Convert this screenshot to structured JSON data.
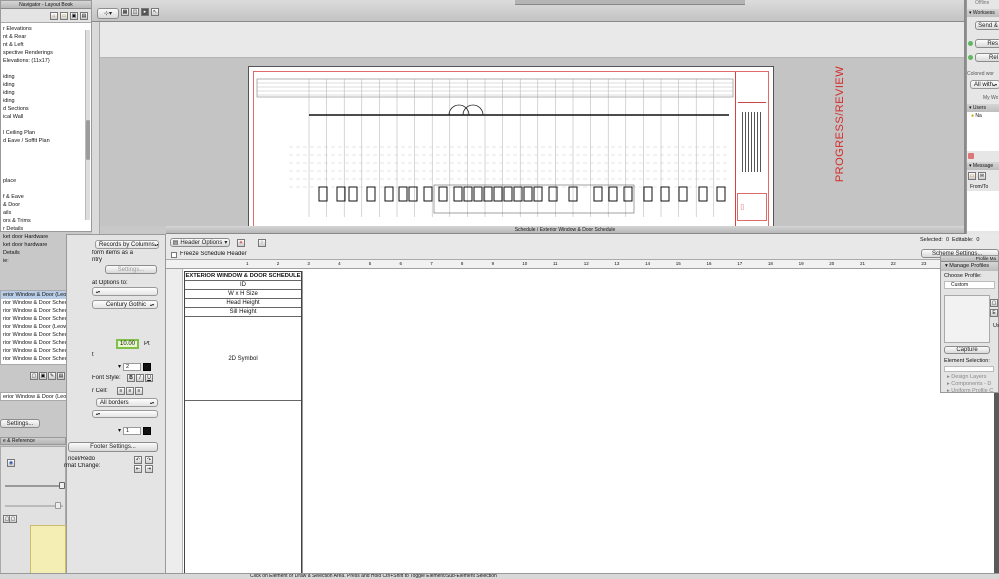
{
  "navigator": {
    "title": "Navigator - Layout Book",
    "items": [
      "r Elevations",
      "nt & Rear",
      "nt & Left",
      "spective Renderings",
      "Elevations: (11x17)",
      "",
      "iding",
      "iding",
      "iding",
      "iding",
      "d Sections",
      "ical Wall",
      "",
      "l Ceiling Plan",
      "d Eave / Soffit Plan",
      "",
      "",
      "",
      "",
      "place",
      "",
      "f & Eave",
      "& Door",
      "ails",
      "ors & Trims",
      "r Details",
      "ket door Hardware",
      "ket door hardware",
      "Details",
      "ie:"
    ],
    "resource_items": [
      "erior Window & Door (Leowen)",
      "rior Window & Door Schedule for Loev",
      "rior Window & Door Schedule for Loev",
      "rior Window & Door Schedule for Loev",
      "rior Window & Door (Leowen)",
      "rior Window & Door Schedule for Loev",
      "rior Window & Door Schedule for Loev",
      "rior Window & Door Schedule for Loev",
      "rior Window & Door Schedule for Loev"
    ],
    "footer_item": "erior Window & Door (Leowen)",
    "settings_label": "Settings...",
    "reference_label": "e & Reference"
  },
  "format_panel": {
    "records_select": "Records by Columns",
    "form_items_text": "form items as a",
    "entry_text": "ntry",
    "settings_btn": "Settings...",
    "format_options_label": "at Options to:",
    "font_select": "Century Gothic",
    "font_size_value": "10.00",
    "font_size_unit": "Pt",
    "line_value": "2",
    "font_style_label": "Font Style:",
    "bold": "B",
    "italic": "I",
    "underline": "U",
    "cell_label": "r Cell:",
    "borders_select": "All borders",
    "border_value": "1",
    "footer_settings": "Footer Settings...",
    "cancel_redo_label": "ncel/Redo",
    "format_change_label": "rmat Change:"
  },
  "drawing": {
    "stamp_text": "PROGRESS/REVIEW",
    "tab_label": "Schedule / Exterior Window & Door Schedule",
    "stamp_color": "#d42a2a"
  },
  "schedule": {
    "header_options": "Header Options",
    "freeze_label": "Freeze Schedule Header",
    "selected_label": "Selected:",
    "selected_value": "0",
    "editable_label": "Editable:",
    "editable_value": "0",
    "scheme_settings": "Scheme Settings...",
    "ruler_numbers": [
      "1",
      "2",
      "3",
      "4",
      "5",
      "6",
      "7",
      "8",
      "9",
      "10",
      "11",
      "12",
      "13",
      "14",
      "15",
      "16",
      "17",
      "18",
      "19",
      "20",
      "21",
      "22",
      "23",
      "24"
    ],
    "title": "EXTERIOR WINDOW & DOOR SCHEDULE",
    "rows": [
      "ID",
      "W x H Size",
      "Head Height",
      "Sill Height"
    ],
    "symbol_label": "2D Symbol"
  },
  "right_palette": {
    "offline": "Offline",
    "worksessions": "Worksess",
    "send_btn": "Send &",
    "res_btn": "Res",
    "rel_btn": "Rel",
    "colored_label": "Colored wor",
    "all_with": "All with",
    "my_label": "My Wo",
    "users_label": "Users",
    "user_na": "Na",
    "messages_label": "Message",
    "from_to": "From/To",
    "profile_title": "Profile Ma",
    "manage_profiles": "Manage Profiles",
    "choose_profile": "Choose Profile:",
    "custom_profile": "Custom",
    "capture_btn": "Capture",
    "element_selection": "Element Selection:",
    "design_layers": "Design Layers",
    "components": "Components - D",
    "uniform_profile": "Uniform Profile C",
    "us_label": "Us"
  },
  "status_bar": {
    "message": "Click on Element or Draw a Selection Area. Press and Hold Ctrl+Shift to Toggle Element/Sub-Element Selection"
  }
}
